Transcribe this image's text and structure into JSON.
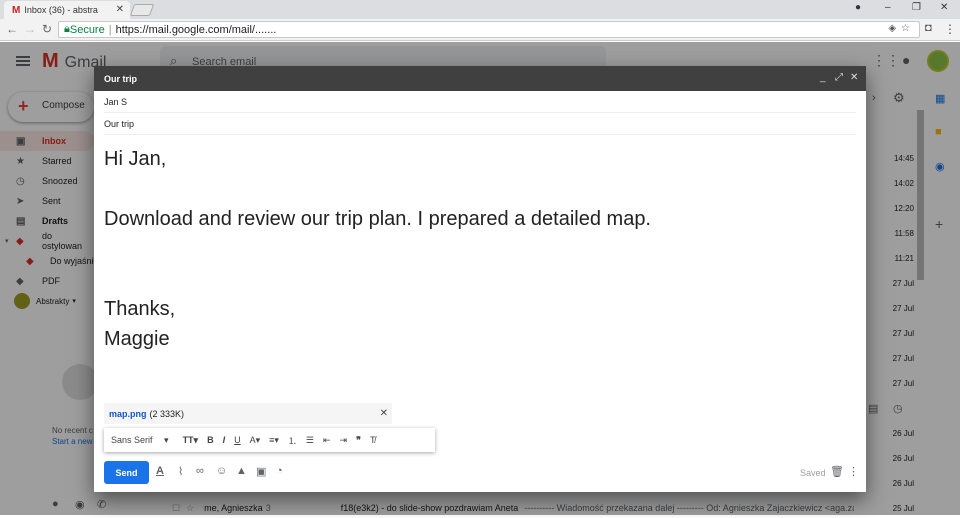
{
  "browser": {
    "tab_title": "Inbox (36) - abstra",
    "tab_favicon": "M",
    "secure_label": "Secure",
    "url": "https://mail.google.com/mail/......."
  },
  "gmail": {
    "logo": "Gmail",
    "search_placeholder": "Search email",
    "compose_label": "Compose",
    "sidebar": [
      {
        "label": "Inbox",
        "icon": "inbox-icon"
      },
      {
        "label": "Starred",
        "icon": "star-icon"
      },
      {
        "label": "Snoozed",
        "icon": "clock-icon"
      },
      {
        "label": "Sent",
        "icon": "send-icon"
      },
      {
        "label": "Drafts",
        "icon": "draft-icon"
      },
      {
        "label": "do ostylowan",
        "icon": "label-icon"
      },
      {
        "label": "Do wyjaśni",
        "icon": "label-icon"
      },
      {
        "label": "PDF",
        "icon": "label-icon"
      }
    ],
    "hangouts_user": "Abstrakty",
    "no_recent": "No recent c",
    "start_new": "Start a new",
    "times": [
      "14:45",
      "14:02",
      "12:20",
      "11:58",
      "11:21",
      "27 Jul",
      "27 Jul",
      "27 Jul",
      "27 Jul",
      "27 Jul",
      "26 Jul",
      "26 Jul",
      "26 Jul",
      "25 Jul"
    ],
    "last_row": {
      "sender": "me, Agnieszka",
      "count": "3",
      "subject": "f18(e3k2) - do slide-show pozdrawiam Aneta",
      "snippet": "---------- Wiadomość przekazana dalej --------- Od: Agnieszka Zajaczkiewicz <aga.zaj..."
    }
  },
  "compose": {
    "title": "Our trip",
    "to": "Jan S",
    "subject": "Our trip",
    "body": {
      "greeting": "Hi Jan,",
      "line1": "Download and review our trip plan. I prepared a detailed map.",
      "closing": "Thanks,",
      "signature": "Maggie"
    },
    "attachment": {
      "filename": "map.png",
      "size": "(2 333K)"
    },
    "font": "Sans Serif",
    "send_label": "Send",
    "saved_label": "Saved"
  },
  "colors": {
    "send": "#1a73e8",
    "gmail_red": "#d93025",
    "header_dark": "#404040"
  }
}
